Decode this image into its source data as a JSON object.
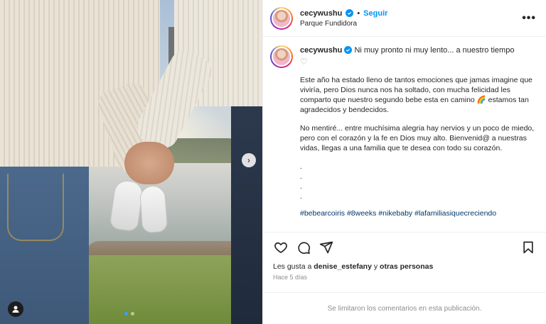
{
  "post": {
    "username": "cecywushu",
    "follow_label": "Seguir",
    "separator": "•",
    "location": "Parque Fundidora",
    "caption_title": "Ni muy pronto ni muy lento... a nuestro tiempo",
    "caption_heart": "♡",
    "caption_p1": "Este año ha estado lleno de tantos emociones que jamas imagine que viviría, pero Dios nunca nos ha soltado, con mucha felicidad les comparto que nuestro segundo bebe esta en camino 🌈 estamos tan agradecidos y bendecidos.",
    "caption_p2": "No mentiré... entre muchísima alegria hay nervios y un poco de miedo, pero con el corazón y la fe en Dios muy alto. Bienvenid@ a nuestras vidas, llegas a una familia que te desea con todo su corazón.",
    "dots": [
      ".",
      ".",
      ".",
      "."
    ],
    "hashtags": "#bebearcoiris #8weeks #nikebaby #lafamiliasiquecreciendo",
    "likes_prefix": "Les gusta a",
    "likes_user": "denise_estefany",
    "likes_mid": "y",
    "likes_others": "otras personas",
    "time_ago": "Hace 5 días",
    "comments_limited": "Se limitaron los comentarios en esta publicación."
  },
  "carousel": {
    "current": 1,
    "total": 2
  },
  "icons": {
    "verified": "verified-badge-icon",
    "more": "more-options-icon",
    "like": "heart-icon",
    "comment": "comment-icon",
    "share": "share-icon",
    "save": "bookmark-icon",
    "next": "chevron-right-icon",
    "tag": "user-tag-icon"
  },
  "colors": {
    "accent": "#0095f6",
    "text": "#262626",
    "muted": "#8e8e8e",
    "hashtag": "#00376b"
  }
}
